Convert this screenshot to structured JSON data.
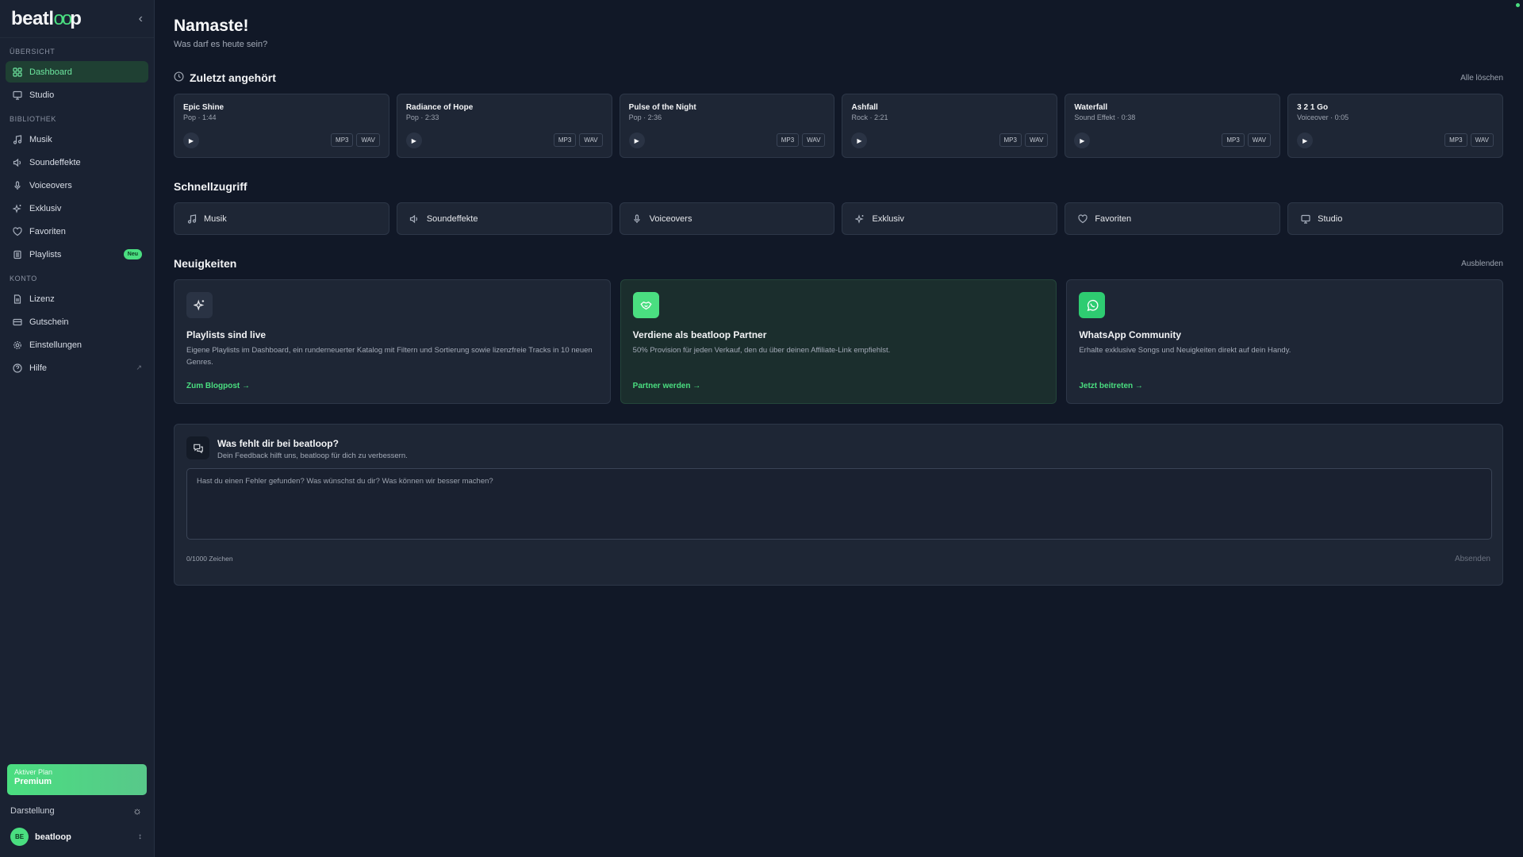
{
  "brand": {
    "logo_pre": "beatl",
    "logo_oo": "oo",
    "logo_post": "p"
  },
  "sidebar": {
    "sections": {
      "overview": "ÜBERSICHT",
      "library": "BIBLIOTHEK",
      "account": "KONTO"
    },
    "items": {
      "dashboard": "Dashboard",
      "studio": "Studio",
      "musik": "Musik",
      "soundeffekte": "Soundeffekte",
      "voiceovers": "Voiceovers",
      "exklusiv": "Exklusiv",
      "favoriten": "Favoriten",
      "playlists": "Playlists",
      "lizenz": "Lizenz",
      "gutschein": "Gutschein",
      "einstellungen": "Einstellungen",
      "hilfe": "Hilfe"
    },
    "playlists_badge": "Neu",
    "plan_label": "Aktiver Plan",
    "plan_name": "Premium",
    "appearance_label": "Darstellung",
    "user_initials": "BE",
    "user_name": "beatloop"
  },
  "header": {
    "greeting": "Namaste!",
    "subtitle": "Was darf es heute sein?"
  },
  "recent": {
    "title": "Zuletzt angehört",
    "clear_all": "Alle löschen",
    "tracks": [
      {
        "title": "Epic Shine",
        "meta": "Pop · 1:44",
        "mp3": "MP3",
        "wav": "WAV"
      },
      {
        "title": "Radiance of Hope",
        "meta": "Pop · 2:33",
        "mp3": "MP3",
        "wav": "WAV"
      },
      {
        "title": "Pulse of the Night",
        "meta": "Pop · 2:36",
        "mp3": "MP3",
        "wav": "WAV"
      },
      {
        "title": "Ashfall",
        "meta": "Rock · 2:21",
        "mp3": "MP3",
        "wav": "WAV"
      },
      {
        "title": "Waterfall",
        "meta": "Sound Effekt · 0:38",
        "mp3": "MP3",
        "wav": "WAV"
      },
      {
        "title": "3 2 1 Go",
        "meta": "Voiceover · 0:05",
        "mp3": "MP3",
        "wav": "WAV"
      }
    ]
  },
  "quick": {
    "title": "Schnellzugriff",
    "items": [
      "Musik",
      "Soundeffekte",
      "Voiceovers",
      "Exklusiv",
      "Favoriten",
      "Studio"
    ]
  },
  "news": {
    "title": "Neuigkeiten",
    "hide": "Ausblenden",
    "cards": [
      {
        "title": "Playlists sind live",
        "desc": "Eigene Playlists im Dashboard, ein runderneuerter Katalog mit Filtern und Sortierung sowie lizenzfreie Tracks in 10 neuen Genres.",
        "link": "Zum Blogpost →"
      },
      {
        "title": "Verdiene als beatloop Partner",
        "desc": "50% Provision für jeden Verkauf, den du über deinen Affiliate-Link empfiehlst.",
        "link": "Partner werden →"
      },
      {
        "title": "WhatsApp Community",
        "desc": "Erhalte exklusive Songs und Neuigkeiten direkt auf dein Handy.",
        "link": "Jetzt beitreten →"
      }
    ]
  },
  "feedback": {
    "title": "Was fehlt dir bei beatloop?",
    "subtitle": "Dein Feedback hilft uns, beatloop für dich zu verbessern.",
    "placeholder": "Hast du einen Fehler gefunden? Was wünschst du dir? Was können wir besser machen?",
    "value": "",
    "counter": "0/1000 Zeichen",
    "submit": "Absenden"
  },
  "colors": {
    "accent": "#4ade80",
    "background": "#111827",
    "sidebar": "#1a2232",
    "card": "#1e2635"
  }
}
